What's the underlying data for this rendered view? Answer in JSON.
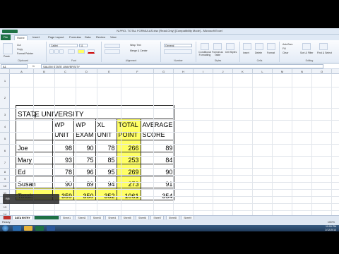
{
  "window": {
    "title": "N-PRO- TOTAL FORMULAS.xlsx [Read-Only] [Compatibility Mode] - Microsoft Excel"
  },
  "ribbon": {
    "tabs": [
      "File",
      "Home",
      "Insert",
      "Page Layout",
      "Formulas",
      "Data",
      "Review",
      "View"
    ],
    "active_tab": "Home",
    "clipboard": {
      "paste": "Paste",
      "cut": "Cut",
      "copy": "Copy",
      "format_painter": "Format Painter",
      "label": "Clipboard"
    },
    "font": {
      "name": "Calibri",
      "size": "11",
      "label": "Font"
    },
    "alignment": {
      "wrap": "Wrap Text",
      "merge": "Merge & Center",
      "label": "Alignment"
    },
    "number": {
      "format": "General",
      "label": "Number"
    },
    "styles": {
      "conditional": "Conditional Formatting",
      "format_table": "Format as Table",
      "cell_styles": "Cell Styles",
      "label": "Styles"
    },
    "cells": {
      "insert": "Insert",
      "delete": "Delete",
      "format": "Format",
      "label": "Cells"
    },
    "editing": {
      "autosum": "AutoSum",
      "fill": "Fill",
      "clear": "Clear",
      "sort": "Sort & Filter",
      "find": "Find & Select",
      "label": "Editing"
    }
  },
  "formula_bar": {
    "name_box": "A1",
    "fx": "fx",
    "value": "SALEM STATE UNIVERSITY"
  },
  "columns": [
    "A",
    "B",
    "C",
    "D",
    "E",
    "F",
    "G",
    "H",
    "I",
    "J",
    "K",
    "L",
    "M",
    "N",
    "O",
    "P"
  ],
  "rows": [
    "1",
    "2",
    "3",
    "4",
    "5",
    "6",
    "7",
    "8",
    "9",
    "10",
    "11",
    "12",
    "13",
    "14",
    "15",
    "16",
    "17",
    "18"
  ],
  "sheet": {
    "title": "STATE UNIVERSITY",
    "headers": [
      {
        "text": "",
        "highlight": false
      },
      {
        "text": "WP UNIT",
        "highlight": false
      },
      {
        "text": "WP EXAM",
        "highlight": false
      },
      {
        "text": "XL UNIT",
        "highlight": false
      },
      {
        "text": "TOTAL POINT",
        "highlight": true
      },
      {
        "text": "AVERAGE SCORE",
        "highlight": false
      }
    ],
    "rows": [
      {
        "name": "Joe",
        "values": [
          "98",
          "90",
          "78",
          "266",
          "89"
        ]
      },
      {
        "name": "Mary",
        "values": [
          "93",
          "75",
          "85",
          "253",
          "84"
        ]
      },
      {
        "name": "Ed",
        "values": [
          "78",
          "96",
          "95",
          "269",
          "90"
        ]
      },
      {
        "name": "Susan",
        "values": [
          "90",
          "89",
          "94",
          "273",
          "91"
        ]
      }
    ],
    "totals": {
      "name": "Totals",
      "values": [
        "359",
        "350",
        "352",
        "1061",
        "354"
      ]
    }
  },
  "sheet_tabs": [
    "",
    "DATA ENTRY",
    "",
    "Sheet1",
    "Sheet2",
    "Sheet3",
    "Sheet4",
    "Sheet5",
    "Sheet6",
    "Sheet7",
    "Sheet8",
    "Sheet9"
  ],
  "status": {
    "ready": "Ready",
    "zoom": "100%"
  },
  "overlay": {
    "label": "RR"
  },
  "tray": {
    "time": "10:09 PM",
    "date": "2/12/2013"
  },
  "colors": {
    "highlight": "#ffff66",
    "excel_green": "#1e7145"
  }
}
